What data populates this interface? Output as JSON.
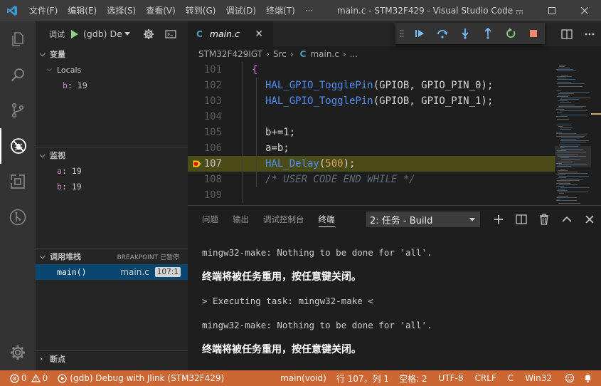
{
  "colors": {
    "statusbar": "#cc6633",
    "activity_bar": "#333333",
    "sidebar": "#252526",
    "editor_bg": "#1e1e1e",
    "accent_blue": "#0078d4",
    "breakpoint": "#e51400",
    "current_line_arrow": "#ffcc00"
  },
  "titlebar": {
    "menu": [
      "文件(F)",
      "编辑(E)",
      "选择(S)",
      "查看(V)",
      "转到(G)",
      "调试(D)",
      "终端(T)"
    ],
    "more": "···",
    "title": "main.c - STM32F429 - Visual Studio Code ..."
  },
  "sidebar": {
    "debug_label": "调试",
    "config": "(gdb) De",
    "variables": {
      "title": "变量",
      "group": "Locals",
      "items": [
        {
          "name": "b",
          "value": "19"
        }
      ]
    },
    "watch": {
      "title": "监视",
      "items": [
        {
          "name": "a",
          "value": "19"
        },
        {
          "name": "b",
          "value": "19"
        }
      ]
    },
    "callstack": {
      "title": "调用堆栈",
      "state": "BREAKPOINT 已暂停",
      "frames": [
        {
          "fn": "main()",
          "file": "main.c",
          "pos": "107:1"
        }
      ]
    },
    "breakpoints": {
      "title": "断点"
    }
  },
  "editor": {
    "tab": {
      "name": "main.c",
      "icon_label": "C"
    },
    "breadcrumb": {
      "project": "STM32F429IGT",
      "folder": "Src",
      "file": "main.c",
      "more": "..."
    },
    "lines": [
      {
        "num": "101",
        "parts": [
          {
            "t": "{",
            "c": "br"
          }
        ]
      },
      {
        "num": "102",
        "parts": [
          {
            "t": "HAL_GPIO_TogglePin",
            "c": "f"
          },
          {
            "t": "(GPIOB, GPIO_PIN_0);",
            "c": "p"
          }
        ]
      },
      {
        "num": "103",
        "parts": [
          {
            "t": "HAL_GPIO_TogglePin",
            "c": "f"
          },
          {
            "t": "(GPIOB, GPIO_PIN_1);",
            "c": "p"
          }
        ]
      },
      {
        "num": "104",
        "parts": []
      },
      {
        "num": "105",
        "parts": [
          {
            "t": "b+=1;",
            "c": "p"
          }
        ]
      },
      {
        "num": "106",
        "parts": [
          {
            "t": "a=b;",
            "c": "p"
          }
        ]
      },
      {
        "num": "107",
        "parts": [
          {
            "t": "HAL_Delay",
            "c": "f"
          },
          {
            "t": "(",
            "c": "p"
          },
          {
            "t": "500",
            "c": "n"
          },
          {
            "t": ");",
            "c": "p"
          }
        ]
      },
      {
        "num": "108",
        "parts": [
          {
            "t": "/* USER CODE END WHILE */",
            "c": "cm"
          }
        ]
      },
      {
        "num": "109",
        "parts": []
      }
    ],
    "current_line": "107"
  },
  "panel": {
    "tabs": [
      "问题",
      "输出",
      "调试控制台",
      "终端"
    ],
    "active_tab": "终端",
    "terminal_select": "2: 任务 - Build",
    "terminal_lines": [
      {
        "text": "mingw32-make: Nothing to be done for 'all'.",
        "cjk": false
      },
      {
        "text": "终端将被任务重用，按任意键关闭。",
        "cjk": true
      },
      {
        "text": "> Executing task: mingw32-make <",
        "cjk": false
      },
      {
        "text": "mingw32-make: Nothing to be done for 'all'.",
        "cjk": false
      },
      {
        "text": "终端将被任务重用，按任意键关闭。",
        "cjk": true
      }
    ]
  },
  "statusbar": {
    "errors": "0",
    "warnings": "0",
    "debug_config": "(gdb) Debug with Jlink (STM32F429)",
    "function": "main(void)",
    "position": "行 107，列 1",
    "spaces": "空格: 2",
    "encoding": "UTF-8",
    "eol": "CRLF",
    "language": "C",
    "platform": "Win32"
  }
}
